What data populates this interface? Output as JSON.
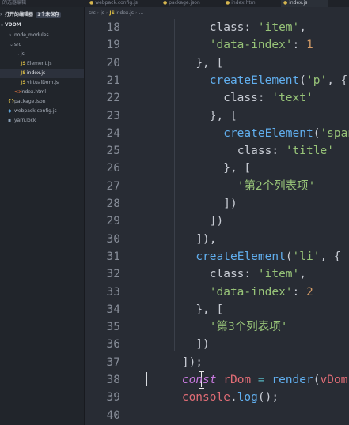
{
  "tabs": [
    {
      "label": "的选器编辑",
      "active": false
    },
    {
      "label": "webpack.config.js",
      "active": false
    },
    {
      "label": "package.json",
      "active": false
    },
    {
      "label": "index.html",
      "active": false
    },
    {
      "label": "index.js",
      "active": true
    }
  ],
  "sidebar": {
    "open_editors_label": "打开的编辑器",
    "unsaved_badge": "1个未保存",
    "project": "VDOM",
    "items": [
      {
        "label": "node_modules",
        "type": "folder",
        "icon": "chevron-right-icon"
      },
      {
        "label": "src",
        "type": "folder",
        "icon": "chevron-down-icon"
      },
      {
        "label": "js",
        "type": "folder",
        "icon": "chevron-down-icon"
      },
      {
        "label": "Element.js",
        "type": "js",
        "icon": "js-file-icon"
      },
      {
        "label": "index.js",
        "type": "js",
        "icon": "js-file-icon",
        "selected": true
      },
      {
        "label": "virtualDom.js",
        "type": "js",
        "icon": "js-file-icon"
      },
      {
        "label": "index.html",
        "type": "html",
        "icon": "html-file-icon"
      },
      {
        "label": "package.json",
        "type": "json",
        "icon": "json-file-icon"
      },
      {
        "label": "webpack.config.js",
        "type": "config",
        "icon": "webpack-file-icon"
      },
      {
        "label": "yarn.lock",
        "type": "lock",
        "icon": "yarn-file-icon"
      }
    ]
  },
  "breadcrumb": {
    "part1": "src",
    "part2": "js",
    "file_icon": "JS",
    "part3": "index.js",
    "part4": "..."
  },
  "editor": {
    "accent_colors": {
      "keyword": "#c678dd",
      "string": "#97c378",
      "number": "#d19a66",
      "function": "#61afef",
      "variable": "#e06c75"
    },
    "lines": [
      {
        "n": "18",
        "tokens": [
          [
            "            ",
            "p"
          ],
          [
            "class",
            "k"
          ],
          [
            ": ",
            "p"
          ],
          [
            "'item'",
            "s"
          ],
          [
            ",",
            "p"
          ]
        ]
      },
      {
        "n": "19",
        "tokens": [
          [
            "            ",
            "p"
          ],
          [
            "'data-index'",
            "s"
          ],
          [
            ": ",
            "p"
          ],
          [
            "1",
            "n"
          ]
        ]
      },
      {
        "n": "20",
        "tokens": [
          [
            "          ",
            "p"
          ],
          [
            "}, [",
            "p"
          ]
        ]
      },
      {
        "n": "21",
        "tokens": [
          [
            "            ",
            "p"
          ],
          [
            "createElement",
            "f"
          ],
          [
            "(",
            "p"
          ],
          [
            "'p'",
            "s"
          ],
          [
            ", {",
            "p"
          ]
        ]
      },
      {
        "n": "22",
        "tokens": [
          [
            "              ",
            "p"
          ],
          [
            "class",
            "k"
          ],
          [
            ": ",
            "p"
          ],
          [
            "'text'",
            "s"
          ]
        ]
      },
      {
        "n": "23",
        "tokens": [
          [
            "            ",
            "p"
          ],
          [
            "}, [",
            "p"
          ]
        ]
      },
      {
        "n": "24",
        "tokens": [
          [
            "              ",
            "p"
          ],
          [
            "createElement",
            "f"
          ],
          [
            "(",
            "p"
          ],
          [
            "'span'",
            "s"
          ],
          [
            ", {",
            "p"
          ]
        ]
      },
      {
        "n": "25",
        "tokens": [
          [
            "                ",
            "p"
          ],
          [
            "class",
            "k"
          ],
          [
            ": ",
            "p"
          ],
          [
            "'title'",
            "s"
          ]
        ]
      },
      {
        "n": "26",
        "tokens": [
          [
            "              ",
            "p"
          ],
          [
            "}, [",
            "p"
          ]
        ]
      },
      {
        "n": "27",
        "tokens": [
          [
            "                ",
            "p"
          ],
          [
            "'第2个列表项'",
            "s"
          ]
        ]
      },
      {
        "n": "28",
        "tokens": [
          [
            "              ",
            "p"
          ],
          [
            "])",
            "p"
          ]
        ]
      },
      {
        "n": "29",
        "tokens": [
          [
            "            ",
            "p"
          ],
          [
            "])",
            "p"
          ]
        ]
      },
      {
        "n": "30",
        "tokens": [
          [
            "          ",
            "p"
          ],
          [
            "]),",
            "p"
          ]
        ]
      },
      {
        "n": "31",
        "tokens": [
          [
            "          ",
            "p"
          ],
          [
            "createElement",
            "f"
          ],
          [
            "(",
            "p"
          ],
          [
            "'li'",
            "s"
          ],
          [
            ", {",
            "p"
          ]
        ]
      },
      {
        "n": "32",
        "tokens": [
          [
            "            ",
            "p"
          ],
          [
            "class",
            "k"
          ],
          [
            ": ",
            "p"
          ],
          [
            "'item'",
            "s"
          ],
          [
            ",",
            "p"
          ]
        ]
      },
      {
        "n": "33",
        "tokens": [
          [
            "            ",
            "p"
          ],
          [
            "'data-index'",
            "s"
          ],
          [
            ": ",
            "p"
          ],
          [
            "2",
            "n"
          ]
        ]
      },
      {
        "n": "34",
        "tokens": [
          [
            "          ",
            "p"
          ],
          [
            "}, [",
            "p"
          ]
        ]
      },
      {
        "n": "35",
        "tokens": [
          [
            "            ",
            "p"
          ],
          [
            "'第3个列表项'",
            "s"
          ]
        ]
      },
      {
        "n": "36",
        "tokens": [
          [
            "          ",
            "p"
          ],
          [
            "])",
            "p"
          ]
        ]
      },
      {
        "n": "37",
        "tokens": [
          [
            "        ",
            "p"
          ],
          [
            "]);",
            "p"
          ]
        ]
      },
      {
        "n": "38",
        "tokens": [
          [
            "        ",
            "p"
          ],
          [
            "const",
            "kw"
          ],
          [
            " ",
            "p"
          ],
          [
            "rDom",
            "v"
          ],
          [
            " ",
            "p"
          ],
          [
            "=",
            "op"
          ],
          [
            " ",
            "p"
          ],
          [
            "render",
            "f"
          ],
          [
            "(",
            "p"
          ],
          [
            "vDom",
            "v"
          ],
          [
            ");",
            "p"
          ]
        ]
      },
      {
        "n": "39",
        "tokens": [
          [
            "        ",
            "p"
          ],
          [
            "console",
            "v"
          ],
          [
            ".",
            "p"
          ],
          [
            "log",
            "f"
          ],
          [
            "();",
            "p"
          ]
        ]
      },
      {
        "n": "40",
        "tokens": []
      }
    ]
  }
}
